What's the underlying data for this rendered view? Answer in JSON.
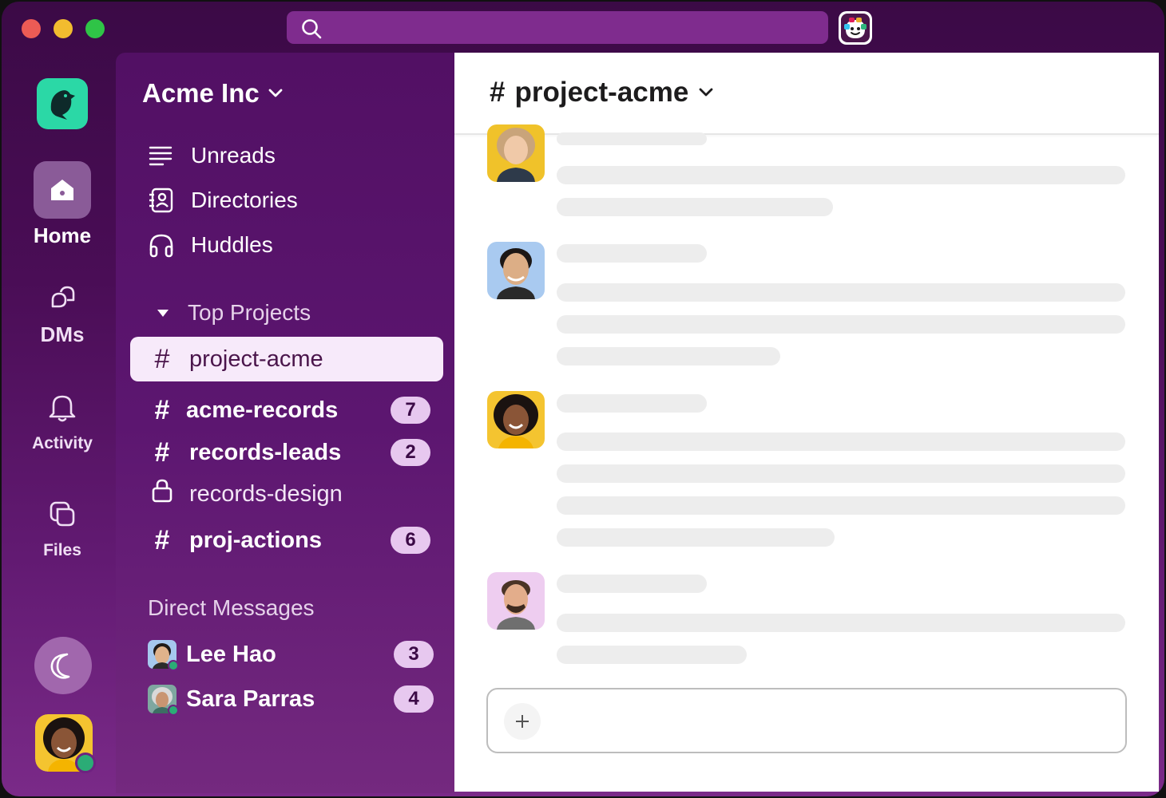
{
  "search": {
    "placeholder": ""
  },
  "rail": {
    "home": "Home",
    "dms": "DMs",
    "activity": "Activity",
    "files": "Files"
  },
  "workspace": {
    "name": "Acme Inc"
  },
  "nav": {
    "unreads": "Unreads",
    "directories": "Directories",
    "huddles": "Huddles"
  },
  "sections": {
    "top_projects": "Top Projects",
    "direct_messages": "Direct Messages"
  },
  "channels": [
    {
      "name": "project-acme",
      "icon": "hash",
      "badge": ""
    },
    {
      "name": "acme-records",
      "icon": "hash",
      "badge": "7"
    },
    {
      "name": "records-leads",
      "icon": "hash",
      "badge": "2"
    },
    {
      "name": "records-design",
      "icon": "lock",
      "badge": ""
    },
    {
      "name": "proj-actions",
      "icon": "hash",
      "badge": "6"
    }
  ],
  "dms": [
    {
      "name": "Lee Hao",
      "badge": "3"
    },
    {
      "name": "Sara Parras",
      "badge": "4"
    }
  ],
  "header": {
    "hash": "#",
    "channel": "project-acme"
  },
  "colors": {
    "aubergine": "#4a154b",
    "accent": "#2bd8a6",
    "presence": "#2bac76"
  }
}
